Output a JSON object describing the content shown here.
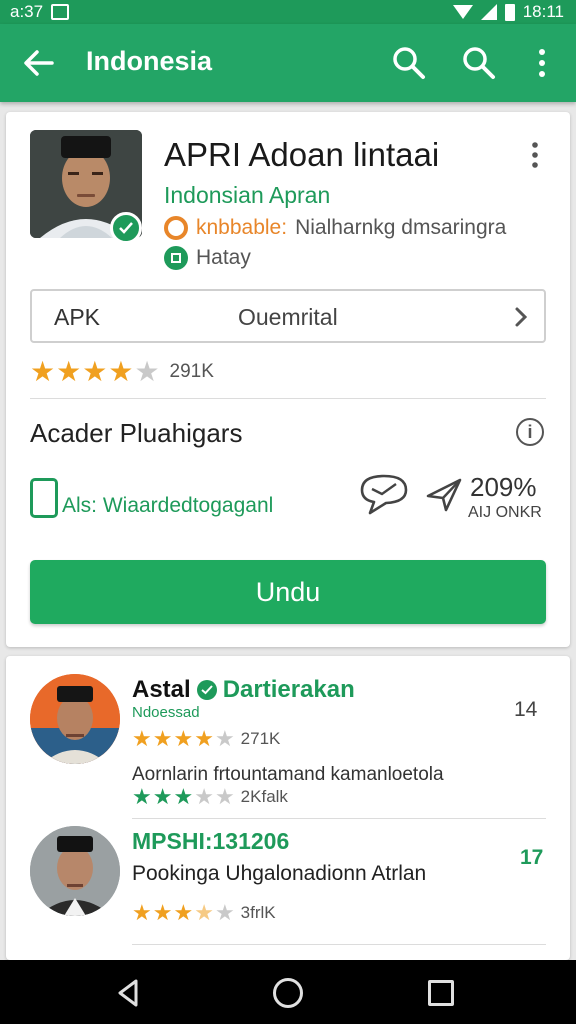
{
  "colors": {
    "primary": "#23a566",
    "accent_green": "#1e9a5a",
    "star": "#f0a020",
    "tag_orange": "#e8862a"
  },
  "status_bar": {
    "time_left": "a:37",
    "time_right": "18:11"
  },
  "app_bar": {
    "title": "Indonesia",
    "icons": [
      "back-arrow-icon",
      "search-icon",
      "search-icon",
      "more-vert-icon"
    ]
  },
  "app": {
    "name": "APRI Adoan lintaai",
    "developer": "Indonsian Apran",
    "tag": "knbbable:",
    "meta_text": "Nialharnkg dmsaringra",
    "meta_line2": "Hatay",
    "apk_label": "APK",
    "apk_value": "Ouemrital",
    "rating_stars": 4,
    "rating_count": "291K",
    "section_title": "Acader Pluahigars",
    "feature_text": "Als: Wiaardedtogaganl",
    "percent_value": "209%",
    "percent_caption": "AIJ ONKR",
    "install_label": "Undu"
  },
  "reviews": [
    {
      "name": "Astal",
      "badge_text": "Dartierakan",
      "subtitle": "Ndoessad",
      "count": "14",
      "stars": 4,
      "rating_count": "271K",
      "text": "Aornlarin frtountamand kamanloetola",
      "stars2": 3,
      "rating_count2": "2Kfalk"
    },
    {
      "name": "MPSHI:131206",
      "count": "17",
      "text": "Pookinga Uhgalonadionn Atrlan",
      "stars": 3.5,
      "rating_count": "3frlK"
    }
  ]
}
